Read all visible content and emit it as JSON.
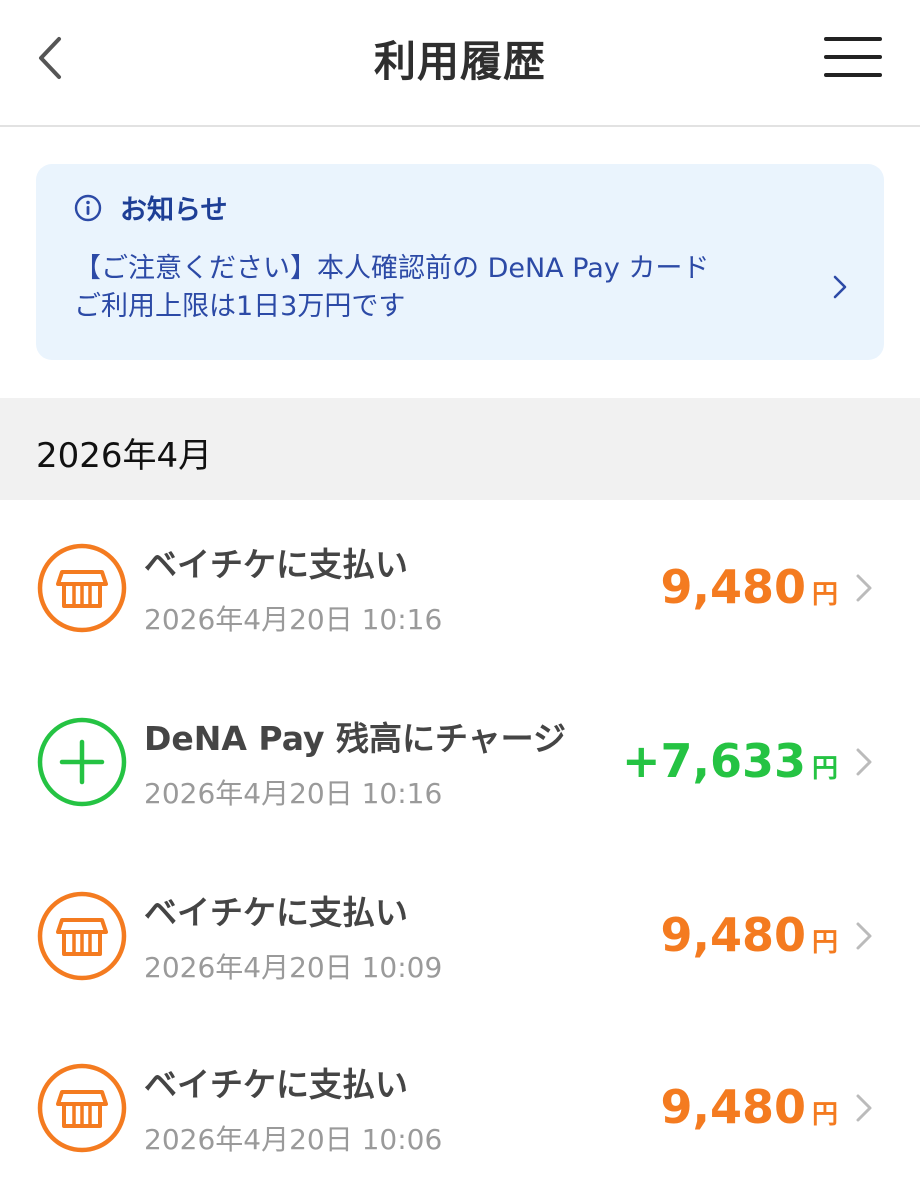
{
  "header": {
    "title": "利用履歴"
  },
  "notice": {
    "title": "お知らせ",
    "line1": "【ご注意ください】本人確認前の DeNA Pay カード",
    "line2": "ご利用上限は1日3万円です"
  },
  "month": {
    "label": "2026年4月"
  },
  "currency_unit": "円",
  "colors": {
    "payment": "#f47b20",
    "charge": "#25c343",
    "notice_text": "#2c4aa6"
  },
  "transactions": [
    {
      "title": "ベイチケに支払い",
      "datetime": "2026年4月20日 10:16",
      "amount": "9,480",
      "type": "payment",
      "icon": "store-icon"
    },
    {
      "title": "DeNA Pay 残高にチャージ",
      "datetime": "2026年4月20日 10:16",
      "amount": "+7,633",
      "type": "charge",
      "icon": "plus-icon"
    },
    {
      "title": "ベイチケに支払い",
      "datetime": "2026年4月20日 10:09",
      "amount": "9,480",
      "type": "payment",
      "icon": "store-icon"
    },
    {
      "title": "ベイチケに支払い",
      "datetime": "2026年4月20日 10:06",
      "amount": "9,480",
      "type": "payment",
      "icon": "store-icon"
    }
  ]
}
